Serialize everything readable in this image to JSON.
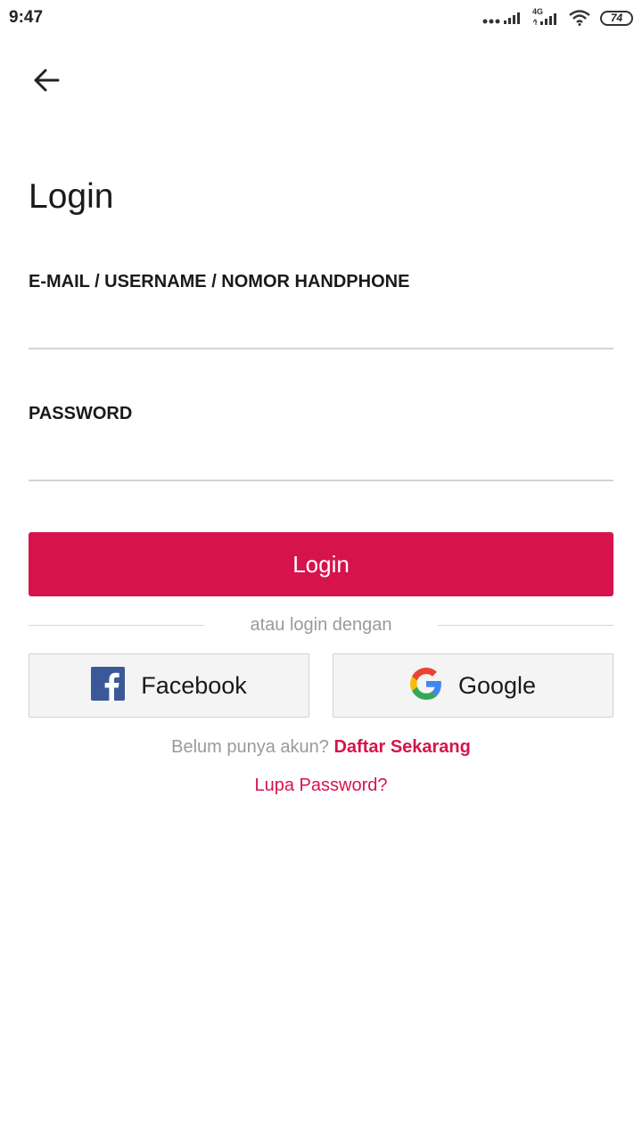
{
  "status_bar": {
    "time": "9:47",
    "network": "4G",
    "battery": "74",
    "icons": [
      "signal-dots-icon",
      "signal-bars-icon",
      "signal-4g-icon",
      "wifi-icon",
      "battery-icon"
    ]
  },
  "header": {
    "back_icon": "arrow-left-icon",
    "title": "Login"
  },
  "form": {
    "identifier_label": "E-MAIL / USERNAME / NOMOR HANDPHONE",
    "identifier_value": "",
    "password_label": "PASSWORD",
    "password_value": "",
    "submit_label": "Login"
  },
  "divider": {
    "text": "atau login dengan"
  },
  "social": {
    "facebook_label": "Facebook",
    "google_label": "Google"
  },
  "footer": {
    "signup_prompt": "Belum punya akun?",
    "signup_link": "Daftar Sekarang",
    "forgot_password": "Lupa Password?"
  },
  "colors": {
    "accent": "#d7134c",
    "muted_text": "#9a9a9a",
    "facebook_blue": "#3b5998"
  }
}
